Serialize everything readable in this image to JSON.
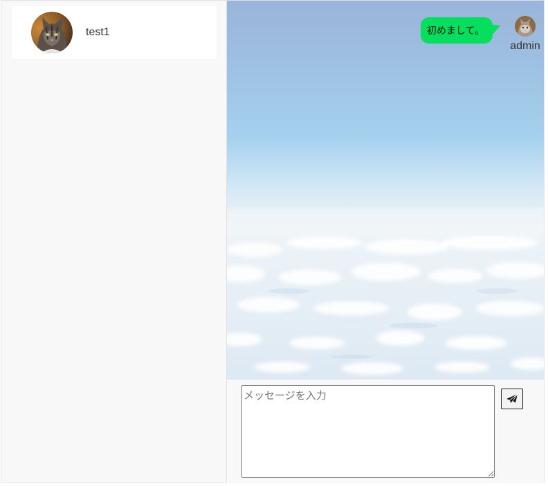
{
  "users": [
    {
      "name": "test1",
      "avatar": "cat-photo"
    }
  ],
  "messages": [
    {
      "text": "初めまして。",
      "sender": "admin",
      "avatar": "cat-photo",
      "bubble_color": "#06de5e"
    }
  ],
  "composer": {
    "placeholder": "メッセージを入力",
    "send_icon": "paper-plane-icon"
  },
  "background": "sky-clouds-photo"
}
